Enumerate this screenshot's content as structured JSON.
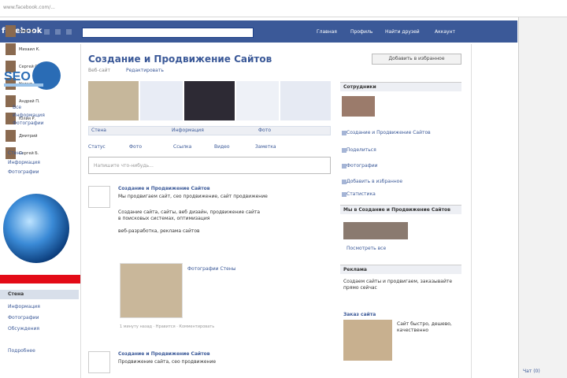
{
  "browser": {
    "url": "www.facebook.com/..."
  },
  "topbar": {
    "logo": "facebook",
    "search_placeholder": "",
    "nav": [
      "Главная",
      "Профиль",
      "Найти друзей",
      "Аккаунт"
    ]
  },
  "sidebar_right": {
    "friends": [
      "Олег К.",
      "Михаил К.",
      "Сергей С.",
      "Наталья",
      "Андрей П.",
      "Юлия Р.",
      "Дмитрий",
      "Сергей Б."
    ],
    "chat_label": "Чат (0)"
  },
  "left": {
    "logo_text": "SEO",
    "info_links": [
      "Все",
      "Информация",
      "Фотографии"
    ],
    "nav_items": [
      "Стена",
      "Информация",
      "Фотографии",
      "Обсуждения"
    ],
    "more_label": "Подробнее"
  },
  "page": {
    "title": "Создание и Продвижение Сайтов",
    "subtitle": "Веб-сайт",
    "edit_label": "Редактировать",
    "add_favorite": "Добавить в избранное"
  },
  "tabs": [
    "Стена",
    "Информация",
    "Фото"
  ],
  "share": [
    "Статус",
    "Фото",
    "Ссылка",
    "Видео",
    "Заметка"
  ],
  "composer_placeholder": "Напишите что-нибудь...",
  "posts": [
    {
      "author": "Создание и Продвижение Сайтов",
      "lines": [
        "Мы продвигаем сайт, сео продвижение, сайт продвижение",
        "Создание сайта, сайты, веб дизайн, продвижение сайта",
        "в поисковых системах, оптимизация",
        "веб-разработка, реклама сайтов"
      ],
      "photo_caption": "Фотографии Стены",
      "meta": "1 минуту назад · Нравится · Комментировать"
    },
    {
      "author": "Создание и Продвижение Сайтов",
      "lines": [
        "Продвижение сайта, сео продвижение"
      ],
      "meta": ""
    }
  ],
  "right": {
    "section1_title": "Сотрудники",
    "section1_links": [
      "Создание и Продвижение Сайтов",
      "Поделиться",
      "Фотографии",
      "Добавить в избранное",
      "Статистика"
    ],
    "section2_title": "Мы в Создание и Продвижение Сайтов",
    "section2_link": "Посмотреть все",
    "section3_title": "Реклама",
    "section3_text": "Создаем сайты и продвигаем, заказывайте прямо сейчас",
    "ad_title": "Заказ сайта",
    "ad_text": "Сайт быстро, дешево, качественно"
  }
}
